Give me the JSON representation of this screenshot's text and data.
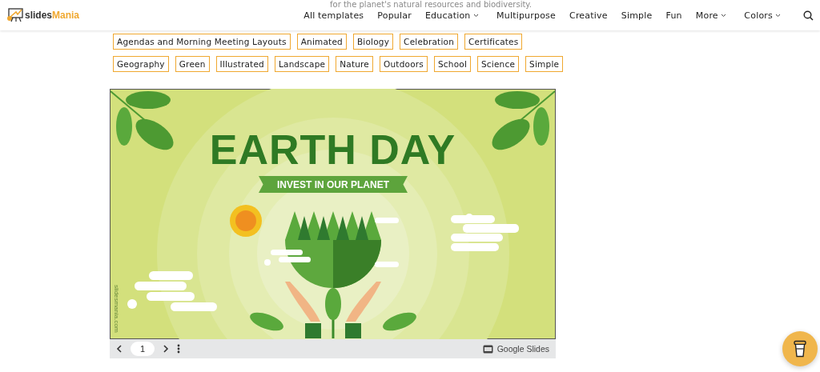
{
  "page": {
    "intro_text": "for the planet's natural resources and biodiversity."
  },
  "header": {
    "logo": {
      "text_dark": "slides",
      "text_accent": "Mania"
    },
    "nav": [
      {
        "label": "All templates",
        "dropdown": false
      },
      {
        "label": "Popular",
        "dropdown": false
      },
      {
        "label": "Education",
        "dropdown": true
      },
      {
        "label": "Multipurpose",
        "dropdown": false
      },
      {
        "label": "Creative",
        "dropdown": false
      },
      {
        "label": "Simple",
        "dropdown": false
      },
      {
        "label": "Fun",
        "dropdown": false
      },
      {
        "label": "More",
        "dropdown": true
      },
      {
        "label": "Colors",
        "dropdown": true
      }
    ]
  },
  "tags": [
    [
      "Agendas and Morning Meeting Layouts",
      "Animated",
      "Biology",
      "Celebration",
      "Certificates"
    ],
    [
      "Geography",
      "Green",
      "Illustrated",
      "Landscape",
      "Nature",
      "Outdoors",
      "School",
      "Science",
      "Simple"
    ]
  ],
  "slide": {
    "title": "EARTH DAY",
    "banner": "INVEST IN OUR PLANET",
    "credit": "slidesmania.com"
  },
  "viewer": {
    "page_number": "1",
    "app_name": "Google Slides"
  }
}
